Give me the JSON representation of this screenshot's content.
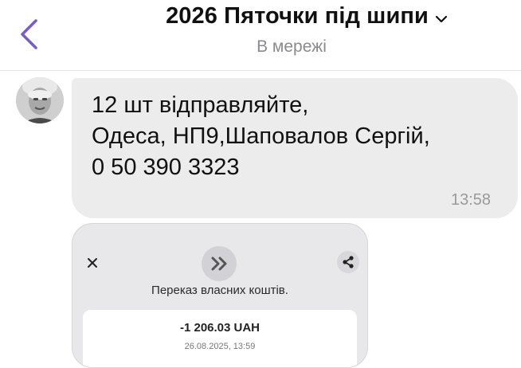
{
  "header": {
    "title": "2026 Пяточки під шипи",
    "status": "В мережі",
    "back_icon": "chevron-left-icon",
    "accent_color": "#7a5fc2"
  },
  "messages": [
    {
      "lines": [
        "12 шт відправляйте,",
        "Одеса, НП9,Шаповалов Сергій,",
        "0 50 390 3323"
      ],
      "time": "13:58",
      "bubble_color": "#ececec"
    }
  ],
  "receipt": {
    "caption": "Переказ власних коштів.",
    "amount": "-1 206.03 UAH",
    "date": "26.08.2025, 13:59",
    "icons": [
      "close-icon",
      "double-chevron-right-icon",
      "share-icon"
    ]
  }
}
